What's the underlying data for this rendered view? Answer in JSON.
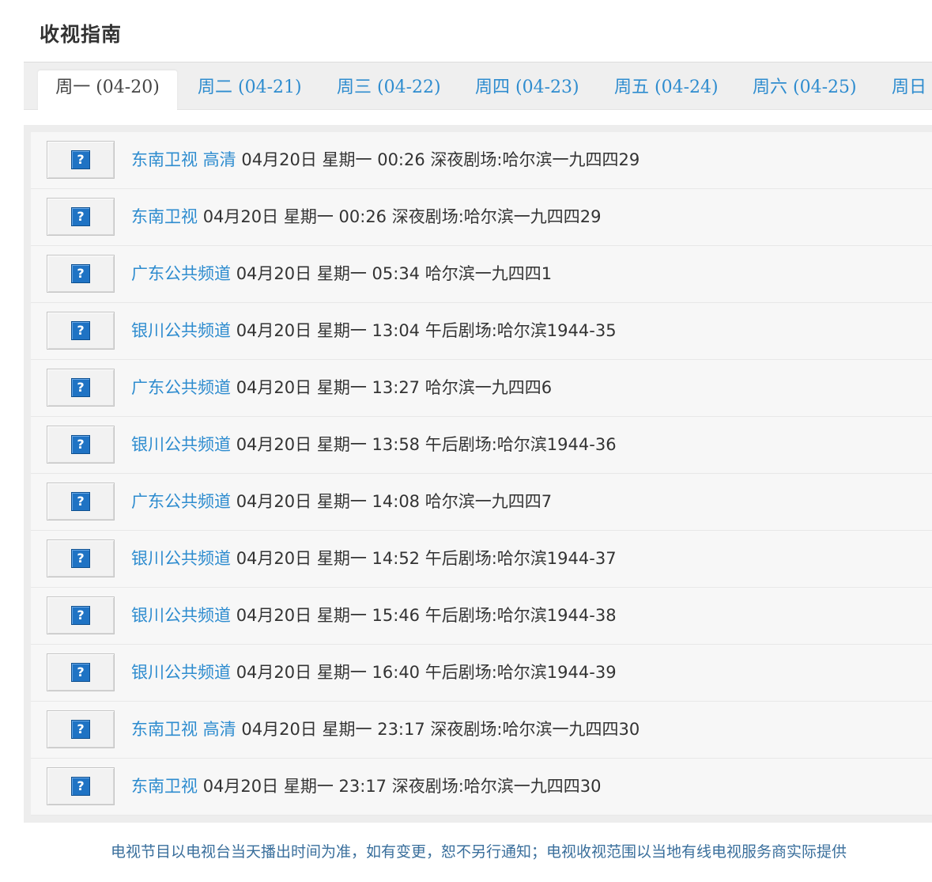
{
  "page": {
    "title": "收视指南"
  },
  "tabs": [
    {
      "label": "周一 (04-20)",
      "active": true
    },
    {
      "label": "周二 (04-21)",
      "active": false
    },
    {
      "label": "周三 (04-22)",
      "active": false
    },
    {
      "label": "周四 (04-23)",
      "active": false
    },
    {
      "label": "周五 (04-24)",
      "active": false
    },
    {
      "label": "周六 (04-25)",
      "active": false
    },
    {
      "label": "周日",
      "active": false
    }
  ],
  "listings": [
    {
      "channel": "东南卫视 高清",
      "date": "04月20日",
      "weekday": "星期一",
      "time": "00:26",
      "program": "深夜剧场:哈尔滨一九四四29"
    },
    {
      "channel": "东南卫视",
      "date": "04月20日",
      "weekday": "星期一",
      "time": "00:26",
      "program": "深夜剧场:哈尔滨一九四四29"
    },
    {
      "channel": "广东公共频道",
      "date": "04月20日",
      "weekday": "星期一",
      "time": "05:34",
      "program": "哈尔滨一九四四1"
    },
    {
      "channel": "银川公共频道",
      "date": "04月20日",
      "weekday": "星期一",
      "time": "13:04",
      "program": "午后剧场:哈尔滨1944-35"
    },
    {
      "channel": "广东公共频道",
      "date": "04月20日",
      "weekday": "星期一",
      "time": "13:27",
      "program": "哈尔滨一九四四6"
    },
    {
      "channel": "银川公共频道",
      "date": "04月20日",
      "weekday": "星期一",
      "time": "13:58",
      "program": "午后剧场:哈尔滨1944-36"
    },
    {
      "channel": "广东公共频道",
      "date": "04月20日",
      "weekday": "星期一",
      "time": "14:08",
      "program": "哈尔滨一九四四7"
    },
    {
      "channel": "银川公共频道",
      "date": "04月20日",
      "weekday": "星期一",
      "time": "14:52",
      "program": "午后剧场:哈尔滨1944-37"
    },
    {
      "channel": "银川公共频道",
      "date": "04月20日",
      "weekday": "星期一",
      "time": "15:46",
      "program": "午后剧场:哈尔滨1944-38"
    },
    {
      "channel": "银川公共频道",
      "date": "04月20日",
      "weekday": "星期一",
      "time": "16:40",
      "program": "午后剧场:哈尔滨1944-39"
    },
    {
      "channel": "东南卫视 高清",
      "date": "04月20日",
      "weekday": "星期一",
      "time": "23:17",
      "program": "深夜剧场:哈尔滨一九四四30"
    },
    {
      "channel": "东南卫视",
      "date": "04月20日",
      "weekday": "星期一",
      "time": "23:17",
      "program": "深夜剧场:哈尔滨一九四四30"
    }
  ],
  "thumb_icon": {
    "glyph": "?",
    "icon": "question-mark-icon",
    "color": "#1f73c4"
  },
  "footer": {
    "note": "电视节目以电视台当天播出时间为准，如有变更，恕不另行通知；电视收视范围以当地有线电视服务商实际提供"
  },
  "colors": {
    "link": "#2e8ccf",
    "text": "#333333",
    "tab_bar_bg": "#efefef",
    "row_bg": "#f7f7f7",
    "footer_text": "#3a6f9c"
  }
}
